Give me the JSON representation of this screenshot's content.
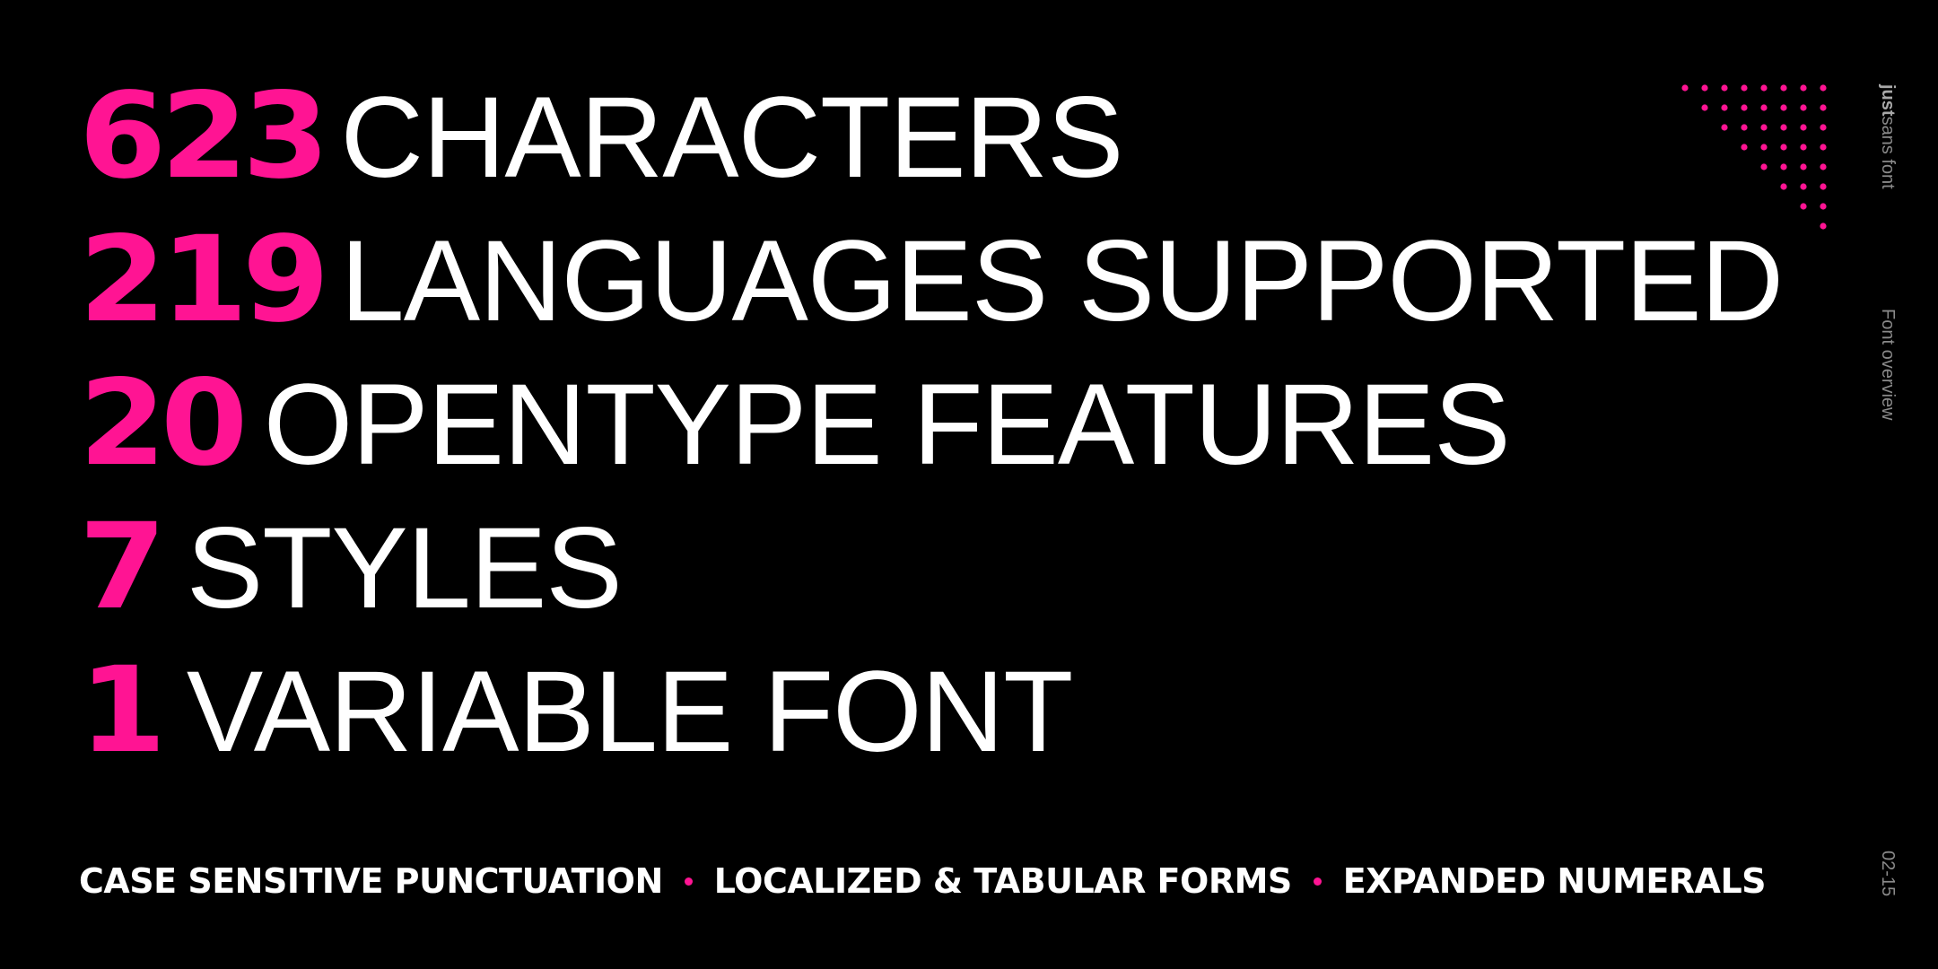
{
  "stats": [
    {
      "number": "623",
      "label": "CHARACTERS"
    },
    {
      "number": "219",
      "label": "LANGUAGES SUPPORTED"
    },
    {
      "number": "20",
      "label": "OPENTYPE FEATURES"
    },
    {
      "number": "7",
      "label": "STYLES"
    },
    {
      "number": "1",
      "label": "VARIABLE FONT"
    }
  ],
  "features": [
    "CASE SENSITIVE PUNCTUATION",
    "LOCALIZED & TABULAR FORMS",
    "EXPANDED NUMERALS"
  ],
  "sidebar": {
    "brand_bold": "just",
    "brand_rest": "sans font",
    "section": "Font overview",
    "page": "02-15"
  },
  "colors": {
    "background": "#000000",
    "accent": "#ff1493",
    "text": "#ffffff",
    "muted": "#8a8a8a"
  },
  "icons": {
    "decoration": "dot-triangle-pattern"
  }
}
